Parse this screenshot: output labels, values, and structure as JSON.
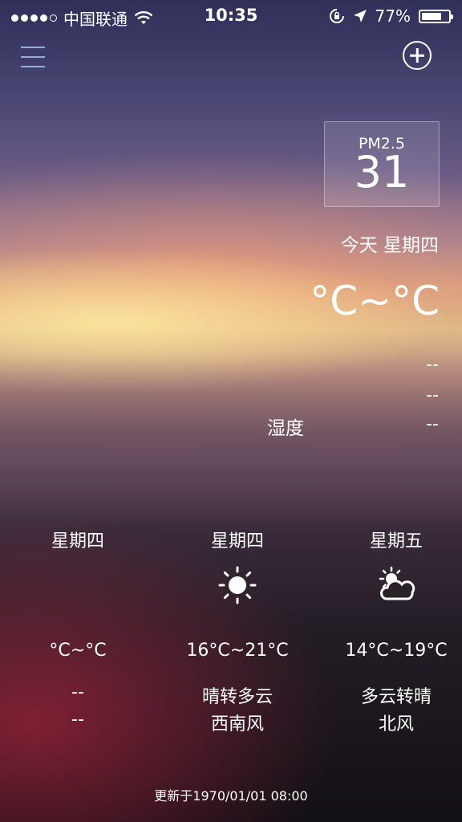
{
  "status_bar": {
    "carrier": "中国联通",
    "time": "10:35",
    "battery": "77%",
    "battery_level": 0.77,
    "signal_bars": 4,
    "signal_max": 5
  },
  "toolbar": {
    "menu_icon": "hamburger-menu-icon",
    "add_icon": "add-circle-icon"
  },
  "pm25": {
    "label": "PM2.5",
    "value": "31"
  },
  "today": {
    "date_label": "今天 星期四",
    "temp_range": "°C~°C",
    "line1": "--",
    "line2": "--",
    "humidity_label": "湿度",
    "humidity_value": "--"
  },
  "forecast": [
    {
      "day": "星期四",
      "icon": "",
      "range": "°C~°C",
      "condition": "--",
      "wind": "--"
    },
    {
      "day": "星期四",
      "icon": "sunny-icon",
      "range": "16°C~21°C",
      "condition": "晴转多云",
      "wind": "西南风"
    },
    {
      "day": "星期五",
      "icon": "partly-cloudy-icon",
      "range": "14°C~19°C",
      "condition": "多云转晴",
      "wind": "北风"
    }
  ],
  "updated_text": "更新于1970/01/01 08:00"
}
